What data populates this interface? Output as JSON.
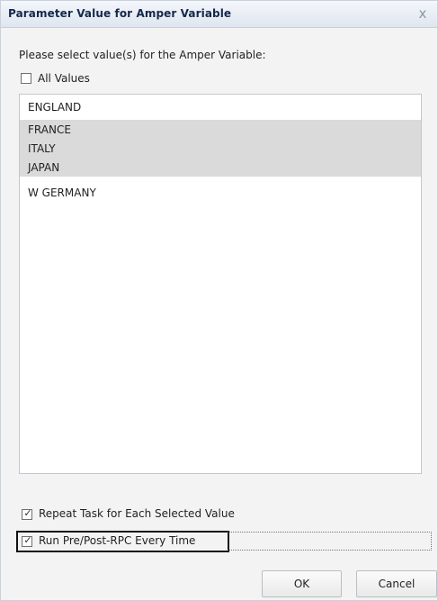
{
  "dialog": {
    "title": "Parameter Value for Amper Variable",
    "close_glyph": "x",
    "prompt": "Please select value(s) for the Amper Variable:",
    "all_values": {
      "label": "All Values",
      "checked": false
    },
    "list_items": [
      {
        "label": "ENGLAND",
        "selected": false
      },
      {
        "label": "FRANCE",
        "selected": true
      },
      {
        "label": "ITALY",
        "selected": true
      },
      {
        "label": "JAPAN",
        "selected": true
      },
      {
        "label": "W GERMANY",
        "selected": false
      }
    ],
    "repeat_task": {
      "label": "Repeat Task for Each Selected Value",
      "checked": true
    },
    "run_rpc": {
      "label": "Run Pre/Post-RPC Every Time",
      "checked": true
    },
    "ok_label": "OK",
    "cancel_label": "Cancel"
  },
  "colors": {
    "title_text": "#15284b",
    "selection": "#dadada",
    "panel_bg": "#f3f3f3"
  }
}
